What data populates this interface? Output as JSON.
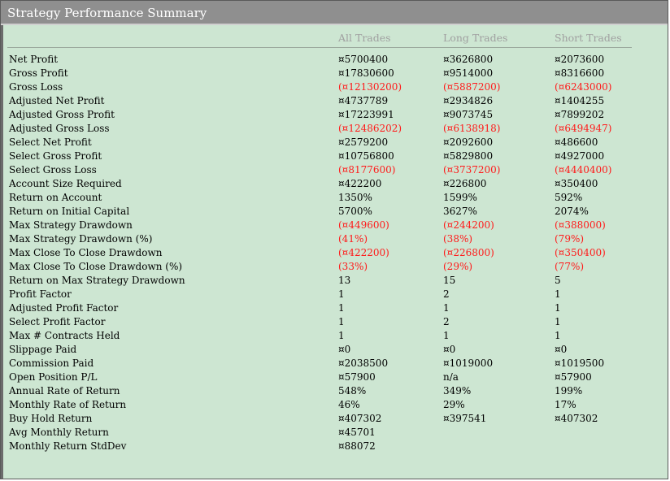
{
  "window": {
    "title": "Strategy Performance Summary"
  },
  "columns": {
    "all": "All Trades",
    "long": "Long Trades",
    "short": "Short Trades"
  },
  "colors": {
    "background": "#cde6d2",
    "title_bar": "#8f8f8f",
    "negative": "#ff1a1a",
    "header_text": "#a0a0a0"
  },
  "rows": [
    {
      "label": "Net Profit",
      "all": "¤5700400",
      "long": "¤3626800",
      "short": "¤2073600",
      "neg": [
        false,
        false,
        false
      ]
    },
    {
      "label": "Gross Profit",
      "all": "¤17830600",
      "long": "¤9514000",
      "short": "¤8316600",
      "neg": [
        false,
        false,
        false
      ]
    },
    {
      "label": "Gross Loss",
      "all": "(¤12130200)",
      "long": "(¤5887200)",
      "short": "(¤6243000)",
      "neg": [
        true,
        true,
        true
      ]
    },
    {
      "label": "Adjusted Net Profit",
      "all": "¤4737789",
      "long": "¤2934826",
      "short": "¤1404255",
      "neg": [
        false,
        false,
        false
      ]
    },
    {
      "label": "Adjusted Gross Profit",
      "all": "¤17223991",
      "long": "¤9073745",
      "short": "¤7899202",
      "neg": [
        false,
        false,
        false
      ]
    },
    {
      "label": "Adjusted Gross Loss",
      "all": "(¤12486202)",
      "long": "(¤6138918)",
      "short": "(¤6494947)",
      "neg": [
        true,
        true,
        true
      ]
    },
    {
      "label": "Select Net Profit",
      "all": "¤2579200",
      "long": "¤2092600",
      "short": "¤486600",
      "neg": [
        false,
        false,
        false
      ]
    },
    {
      "label": "Select Gross Profit",
      "all": "¤10756800",
      "long": "¤5829800",
      "short": "¤4927000",
      "neg": [
        false,
        false,
        false
      ]
    },
    {
      "label": "Select Gross Loss",
      "all": "(¤8177600)",
      "long": "(¤3737200)",
      "short": "(¤4440400)",
      "neg": [
        true,
        true,
        true
      ]
    },
    {
      "label": "Account Size Required",
      "all": "¤422200",
      "long": "¤226800",
      "short": "¤350400",
      "neg": [
        false,
        false,
        false
      ]
    },
    {
      "label": "Return on Account",
      "all": "1350%",
      "long": "1599%",
      "short": "592%",
      "neg": [
        false,
        false,
        false
      ]
    },
    {
      "label": "Return on Initial Capital",
      "all": "5700%",
      "long": "3627%",
      "short": "2074%",
      "neg": [
        false,
        false,
        false
      ]
    },
    {
      "label": "Max Strategy Drawdown",
      "all": "(¤449600)",
      "long": "(¤244200)",
      "short": "(¤388000)",
      "neg": [
        true,
        true,
        true
      ]
    },
    {
      "label": "Max Strategy Drawdown (%)",
      "all": "(41%)",
      "long": "(38%)",
      "short": "(79%)",
      "neg": [
        true,
        true,
        true
      ]
    },
    {
      "label": "Max Close To Close Drawdown",
      "all": "(¤422200)",
      "long": "(¤226800)",
      "short": "(¤350400)",
      "neg": [
        true,
        true,
        true
      ]
    },
    {
      "label": "Max Close To Close Drawdown (%)",
      "all": "(33%)",
      "long": "(29%)",
      "short": "(77%)",
      "neg": [
        true,
        true,
        true
      ]
    },
    {
      "label": "Return on Max Strategy Drawdown",
      "all": "13",
      "long": "15",
      "short": "5",
      "neg": [
        false,
        false,
        false
      ]
    },
    {
      "label": "Profit Factor",
      "all": "1",
      "long": "2",
      "short": "1",
      "neg": [
        false,
        false,
        false
      ]
    },
    {
      "label": "Adjusted Profit Factor",
      "all": "1",
      "long": "1",
      "short": "1",
      "neg": [
        false,
        false,
        false
      ]
    },
    {
      "label": "Select Profit Factor",
      "all": "1",
      "long": "2",
      "short": "1",
      "neg": [
        false,
        false,
        false
      ]
    },
    {
      "label": "Max # Contracts Held",
      "all": "1",
      "long": "1",
      "short": "1",
      "neg": [
        false,
        false,
        false
      ]
    },
    {
      "label": "Slippage Paid",
      "all": "¤0",
      "long": "¤0",
      "short": "¤0",
      "neg": [
        false,
        false,
        false
      ]
    },
    {
      "label": "Commission Paid",
      "all": "¤2038500",
      "long": "¤1019000",
      "short": "¤1019500",
      "neg": [
        false,
        false,
        false
      ]
    },
    {
      "label": "Open Position P/L",
      "all": "¤57900",
      "long": "n/a",
      "short": "¤57900",
      "neg": [
        false,
        false,
        false
      ]
    },
    {
      "label": "Annual Rate of Return",
      "all": "548%",
      "long": "349%",
      "short": "199%",
      "neg": [
        false,
        false,
        false
      ]
    },
    {
      "label": "Monthly Rate of Return",
      "all": "46%",
      "long": "29%",
      "short": "17%",
      "neg": [
        false,
        false,
        false
      ]
    },
    {
      "label": "Buy  Hold Return",
      "all": "¤407302",
      "long": "¤397541",
      "short": "¤407302",
      "neg": [
        false,
        false,
        false
      ]
    },
    {
      "label": "Avg Monthly Return",
      "all": "¤45701",
      "long": "",
      "short": "",
      "neg": [
        false,
        false,
        false
      ]
    },
    {
      "label": "Monthly Return StdDev",
      "all": "¤88072",
      "long": "",
      "short": "",
      "neg": [
        false,
        false,
        false
      ]
    }
  ]
}
